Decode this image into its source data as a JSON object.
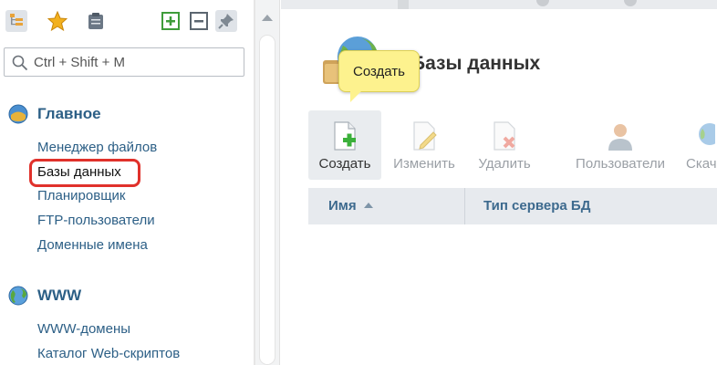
{
  "sidebar": {
    "search": {
      "placeholder": "Ctrl + Shift + M",
      "value": ""
    },
    "groups": [
      {
        "title": "Главное",
        "items": [
          "Менеджер файлов",
          "Базы данных",
          "Планировщик",
          "FTP-пользователи",
          "Доменные имена"
        ],
        "selected_item": "Базы данных"
      },
      {
        "title": "WWW",
        "items": [
          "WWW-домены",
          "Каталог Web-скриптов"
        ]
      }
    ]
  },
  "main": {
    "title": "Базы данных",
    "tooltip": "Создать",
    "toolbar": [
      {
        "label": "Создать",
        "icon": "new-document-plus-icon",
        "enabled": true
      },
      {
        "label": "Изменить",
        "icon": "edit-document-icon",
        "enabled": false
      },
      {
        "label": "Удалить",
        "icon": "delete-document-icon",
        "enabled": false
      },
      {
        "label": "Пользователи",
        "icon": "users-icon",
        "enabled": false
      },
      {
        "label": "Скач",
        "icon": "globe-download-icon",
        "enabled": false
      }
    ],
    "table": {
      "columns": [
        "Имя",
        "Тип сервера БД"
      ],
      "sorted_column": "Имя",
      "sort_direction": "ascending",
      "rows": []
    }
  },
  "colors": {
    "link": "#2c5f86",
    "highlight_border": "#e0312b",
    "tooltip_bg": "#fdf28e",
    "header_bg": "#e7eaee"
  }
}
